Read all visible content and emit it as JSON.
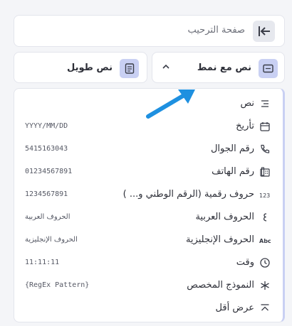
{
  "header": {
    "title": "صفحة الترحيب"
  },
  "fields": [
    {
      "label": "نص طويل"
    },
    {
      "label": "نص مع نمط"
    }
  ],
  "menu": {
    "items": [
      {
        "label": "نص",
        "example": "",
        "icon": "text-lines-icon"
      },
      {
        "label": "تأريخ",
        "example": "YYYY/MM/DD",
        "icon": "calendar-icon"
      },
      {
        "label": "رقم الجوال",
        "example": "5415163043",
        "icon": "phone-icon"
      },
      {
        "label": "رقم الهاتف",
        "example": "01234567891",
        "icon": "telephone-icon"
      },
      {
        "label": "حروف رقمية (الرقم الوطني و... )",
        "example": "1234567891",
        "icon": "numeric-123-icon"
      },
      {
        "label": "الحروف العربية",
        "example": "الحروف العربية",
        "icon": "arabic-letter-icon"
      },
      {
        "label": "الحروف الإنجليزية",
        "example": "الحروف الإنجليزية",
        "icon": "abc-icon"
      },
      {
        "label": "وقت",
        "example": "11:11:11",
        "icon": "clock-icon"
      },
      {
        "label": "النموذج المخصص",
        "example": "{RegEx Pattern}",
        "icon": "star-icon"
      },
      {
        "label": "عرض أقل",
        "example": "",
        "icon": "collapse-icon"
      }
    ]
  },
  "colors": {
    "accent": "#c9d0f3",
    "arrow": "#1e90e0"
  }
}
